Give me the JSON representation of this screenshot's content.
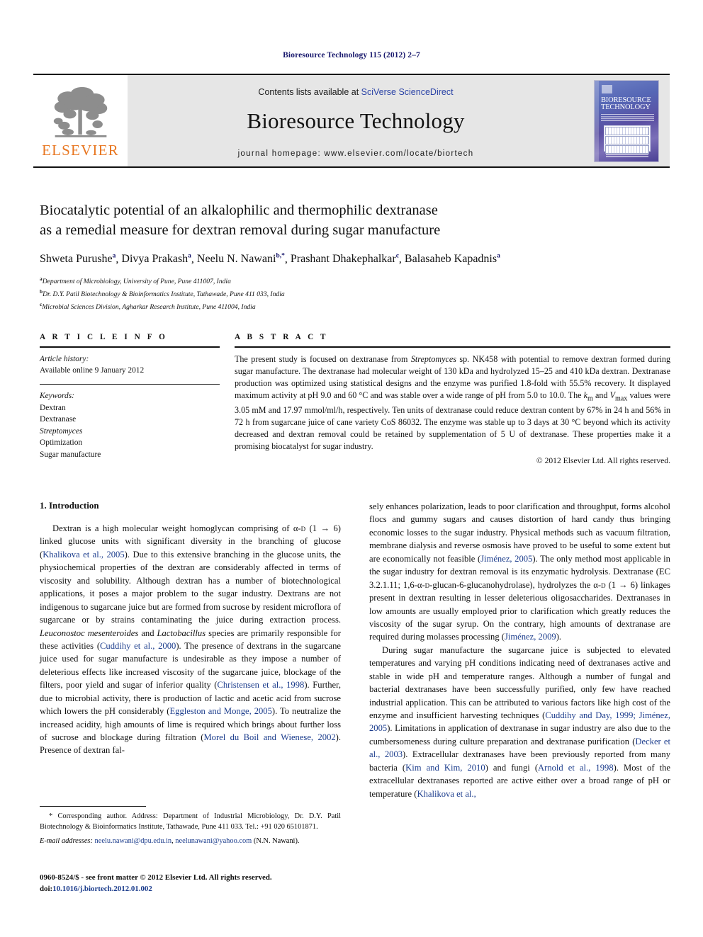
{
  "running_head": "Bioresource Technology 115 (2012) 2–7",
  "masthead": {
    "publisher_logo_text": "ELSEVIER",
    "contents_prefix": "Contents lists available at ",
    "contents_link": "SciVerse ScienceDirect",
    "journal_name": "Bioresource Technology",
    "homepage": "journal homepage: www.elsevier.com/locate/biortech",
    "cover": {
      "title_line1": "BIORESOURCE",
      "title_line2": "TECHNOLOGY"
    }
  },
  "article": {
    "title_line1": "Biocatalytic potential of an alkalophilic and thermophilic dextranase",
    "title_line2": "as a remedial measure for dextran removal during sugar manufacture",
    "authors": [
      {
        "name": "Shweta Purushe",
        "mark": "a"
      },
      {
        "name": "Divya Prakash",
        "mark": "a"
      },
      {
        "name": "Neelu N. Nawani",
        "mark": "b,*"
      },
      {
        "name": "Prashant Dhakephalkar",
        "mark": "c"
      },
      {
        "name": "Balasaheb Kapadnis",
        "mark": "a"
      }
    ],
    "affiliations": [
      {
        "mark": "a",
        "text": "Department of Microbiology, University of Pune, Pune 411007, India"
      },
      {
        "mark": "b",
        "text": "Dr. D.Y. Patil Biotechnology & Bioinformatics Institute, Tathawade, Pune 411 033, India"
      },
      {
        "mark": "c",
        "text": "Microbial Sciences Division, Agharkar Research Institute, Pune 411004, India"
      }
    ]
  },
  "article_info": {
    "heading": "A R T I C L E  I N F O",
    "history_label": "Article history:",
    "history_value": "Available online 9 January 2012",
    "keywords_label": "Keywords:",
    "keywords": [
      {
        "text": "Dextran",
        "italic": false
      },
      {
        "text": "Dextranase",
        "italic": false
      },
      {
        "text": "Streptomyces",
        "italic": true
      },
      {
        "text": "Optimization",
        "italic": false
      },
      {
        "text": "Sugar manufacture",
        "italic": false
      }
    ]
  },
  "abstract": {
    "heading": "A B S T R A C T",
    "body_html": "The present study is focused on dextranase from <i>Streptomyces</i> sp. NK458 with potential to remove dextran formed during sugar manufacture. The dextranase had molecular weight of 130 kDa and hydrolyzed 15–25 and 410 kDa dextran. Dextranase production was optimized using statistical designs and the enzyme was purified 1.8-fold with 55.5% recovery. It displayed maximum activity at pH 9.0 and 60 °C and was stable over a wide range of pH from 5.0 to 10.0. The <i>k</i><sub>m</sub> and <i>V</i><sub>max</sub> values were 3.05 mM and 17.97 mmol/ml/h, respectively. Ten units of dextranase could reduce dextran content by 67% in 24 h and 56% in 72 h from sugarcane juice of cane variety CoS 86032. The enzyme was stable up to 3 days at 30 °C beyond which its activity decreased and dextran removal could be retained by supplementation of 5 U of dextranase. These properties make it a promising biocatalyst for sugar industry.",
    "copyright": "© 2012 Elsevier Ltd. All rights reserved."
  },
  "body": {
    "section_heading": "1. Introduction",
    "left_paragraphs_html": [
      "Dextran is a high molecular weight homoglycan comprising of α-<span style=\"font-variant:small-caps\">d</span> (1 → 6) linked glucose units with significant diversity in the branching of glucose (<span class=\"cite\">Khalikova et al., 2005</span>). Due to this extensive branching in the glucose units, the physiochemical properties of the dextran are considerably affected in terms of viscosity and solubility. Although dextran has a number of biotechnological applications, it poses a major problem to the sugar industry. Dextrans are not indigenous to sugarcane juice but are formed from sucrose by resident microflora of sugarcane or by strains contaminating the juice during extraction process. <i>Leuconostoc mesenteroides</i> and <i>Lactobacillus</i> species are primarily responsible for these activities (<span class=\"cite\">Cuddihy et al., 2000</span>). The presence of dextrans in the sugarcane juice used for sugar manufacture is undesirable as they impose a number of deleterious effects like increased viscosity of the sugarcane juice, blockage of the filters, poor yield and sugar of inferior quality (<span class=\"cite\">Christensen et al., 1998</span>). Further, due to microbial activity, there is production of lactic and acetic acid from sucrose which lowers the pH considerably (<span class=\"cite\">Eggleston and Monge, 2005</span>). To neutralize the increased acidity, high amounts of lime is required which brings about further loss of sucrose and blockage during filtration (<span class=\"cite\">Morel du Boil and Wienese, 2002</span>). Presence of dextran fal-"
    ],
    "right_paragraphs_html": [
      "sely enhances polarization, leads to poor clarification and throughput, forms alcohol flocs and gummy sugars and causes distortion of hard candy thus bringing economic losses to the sugar industry. Physical methods such as vacuum filtration, membrane dialysis and reverse osmosis have proved to be useful to some extent but are economically not feasible (<span class=\"cite\">Jiménez, 2005</span>). The only method most applicable in the sugar industry for dextran removal is its enzymatic hydrolysis. Dextranase (EC 3.2.1.11; 1,6-α-<span style=\"font-variant:small-caps\">d</span>-glucan-6-glucanohydrolase), hydrolyzes the α-<span style=\"font-variant:small-caps\">d</span> (1 → 6) linkages present in dextran resulting in lesser deleterious oligosaccharides. Dextranases in low amounts are usually employed prior to clarification which greatly reduces the viscosity of the sugar syrup. On the contrary, high amounts of dextranase are required during molasses processing (<span class=\"cite\">Jiménez, 2009</span>).",
      "During sugar manufacture the sugarcane juice is subjected to elevated temperatures and varying pH conditions indicating need of dextranases active and stable in wide pH and temperature ranges. Although a number of fungal and bacterial dextranases have been successfully purified, only few have reached industrial application. This can be attributed to various factors like high cost of the enzyme and insufficient harvesting techniques (<span class=\"cite\">Cuddihy and Day, 1999; Jiménez, 2005</span>). Limitations in application of dextranase in sugar industry are also due to the cumbersomeness during culture preparation and dextranase purification (<span class=\"cite\">Decker et al., 2003</span>). Extracellular dextranases have been previously reported from many bacteria (<span class=\"cite\">Kim and Kim, 2010</span>) and fungi (<span class=\"cite\">Arnold et al., 1998</span>). Most of the extracellular dextranases reported are active either over a broad range of pH or temperature (<span class=\"cite\">Khalikova et al.,</span>"
    ]
  },
  "footnote": {
    "corresponding_html": "* Corresponding author. Address: Department of Industrial Microbiology, Dr. D.Y. Patil Biotechnology &amp; Bioinformatics Institute, Tathawade, Pune 411 033. Tel.: +91 020 65101871.",
    "email_label": "E-mail addresses:",
    "emails": [
      "neelu.nawani@dpu.edu.in",
      "neelunawani@yahoo.com"
    ],
    "email_attrib": "(N.N. Nawani)."
  },
  "colophon": {
    "line1": "0960-8524/$ - see front matter © 2012 Elsevier Ltd. All rights reserved.",
    "doi_label": "doi:",
    "doi_value": "10.1016/j.biortech.2012.01.002"
  },
  "colors": {
    "link_blue": "#1b3c8c",
    "running_head_blue": "#1a1a6e",
    "elsevier_orange": "#E87722",
    "masthead_grey": "#e6e6e6"
  }
}
